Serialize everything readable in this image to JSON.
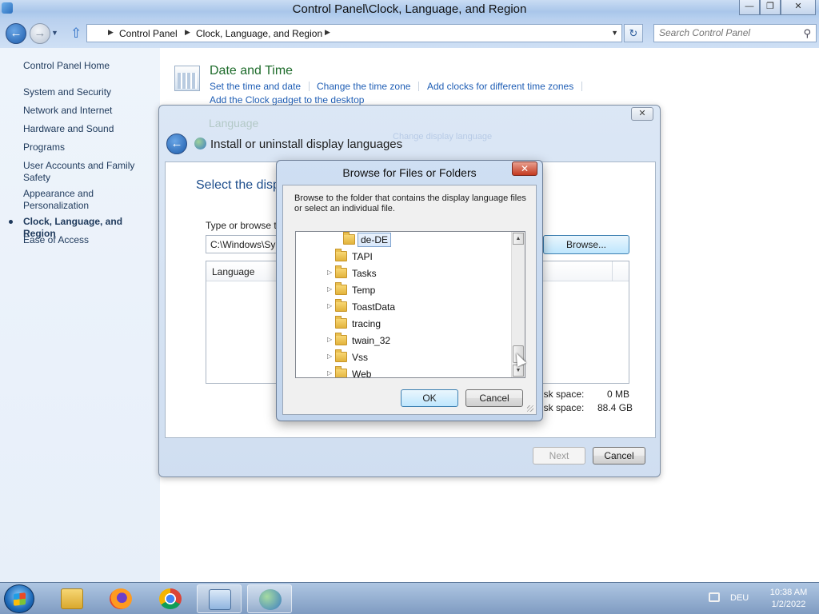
{
  "window": {
    "title": "Control Panel\\Clock, Language, and Region",
    "minimize": "—",
    "maximize": "❐",
    "close": "✕"
  },
  "address": {
    "crumbs": [
      "Control Panel",
      "Clock, Language, and Region"
    ],
    "search_placeholder": "Search Control Panel"
  },
  "sidebar": {
    "items": [
      {
        "label": "Control Panel Home"
      },
      {
        "label": "System and Security"
      },
      {
        "label": "Network and Internet"
      },
      {
        "label": "Hardware and Sound"
      },
      {
        "label": "Programs"
      },
      {
        "label": "User Accounts and Family Safety"
      },
      {
        "label": "Appearance and Personalization"
      },
      {
        "label": "Clock, Language, and Region"
      },
      {
        "label": "Ease of Access"
      }
    ]
  },
  "category": {
    "title": "Date and Time",
    "links": [
      "Set the time and date",
      "Change the time zone",
      "Add clocks for different time zones",
      "Add the Clock gadget to the desktop"
    ],
    "ghost_title": "Language",
    "ghost_link": "Change display language"
  },
  "install_dialog": {
    "heading": "Install or uninstall display languages",
    "select_text": "Select the disp",
    "type_label": "Type or browse t",
    "path_value": "C:\\Windows\\Sy",
    "browse_label": "Browse...",
    "list_header": "Language",
    "disk1_label": "isk space:",
    "disk1_value": "0 MB",
    "disk2_label": "isk space:",
    "disk2_value": "88.4 GB",
    "next_label": "Next",
    "cancel_label": "Cancel",
    "close_icon": "✕"
  },
  "browse_dialog": {
    "title": "Browse for Files or Folders",
    "description": "Browse to the folder that contains the display language files or select an individual file.",
    "tree": [
      {
        "name": "de-DE",
        "expander": false,
        "selected": true
      },
      {
        "name": "TAPI",
        "expander": false,
        "selected": false
      },
      {
        "name": "Tasks",
        "expander": true,
        "selected": false
      },
      {
        "name": "Temp",
        "expander": true,
        "selected": false
      },
      {
        "name": "ToastData",
        "expander": true,
        "selected": false
      },
      {
        "name": "tracing",
        "expander": false,
        "selected": false
      },
      {
        "name": "twain_32",
        "expander": true,
        "selected": false
      },
      {
        "name": "Vss",
        "expander": true,
        "selected": false
      },
      {
        "name": "Web",
        "expander": true,
        "selected": false
      }
    ],
    "ok_label": "OK",
    "cancel_label": "Cancel",
    "close_icon": "✕"
  },
  "taskbar": {
    "lang": "DEU",
    "time": "10:38 AM",
    "date": "1/2/2022"
  },
  "colors": {
    "link": "#1f5eb5",
    "category_title": "#1d6b2a",
    "close_red": "#c4391f"
  }
}
